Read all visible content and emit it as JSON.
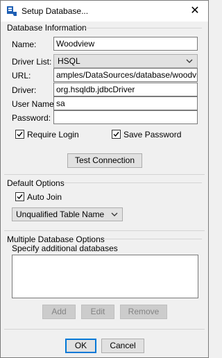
{
  "window": {
    "title": "Setup Database...",
    "close_glyph": "✕"
  },
  "database_information": {
    "title": "Database Information",
    "name_label": "Name:",
    "name_value": "Woodview",
    "driver_list_label": "Driver List:",
    "driver_list_value": "HSQL",
    "url_label": "URL:",
    "url_value": "amples/DataSources/database/woodview",
    "driver_label": "Driver:",
    "driver_value": "org.hsqldb.jdbcDriver",
    "user_name_label": "User Name:",
    "user_name_value": "sa",
    "password_label": "Password:",
    "password_value": "",
    "require_login_label": "Require Login",
    "require_login_checked": true,
    "save_password_label": "Save Password",
    "save_password_checked": true,
    "test_connection_label": "Test Connection"
  },
  "default_options": {
    "title": "Default Options",
    "auto_join_label": "Auto Join",
    "auto_join_checked": true,
    "table_name_value": "Unqualified Table Name"
  },
  "multiple_database_options": {
    "title": "Multiple Database Options",
    "specify_label": "Specify additional databases",
    "databases": [],
    "add_label": "Add",
    "edit_label": "Edit",
    "remove_label": "Remove"
  },
  "footer": {
    "ok_label": "OK",
    "cancel_label": "Cancel"
  },
  "colors": {
    "accent": "#0078d7",
    "icon_blue": "#1e5fb4"
  }
}
